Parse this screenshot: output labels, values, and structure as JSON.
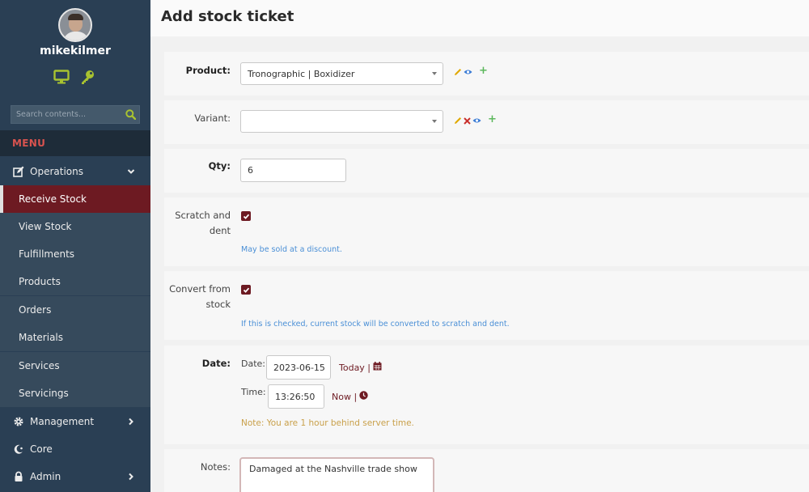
{
  "user": {
    "name": "mikekilmer"
  },
  "sidebar": {
    "search_placeholder": "Search contents...",
    "menu_label": "MENU",
    "groups": {
      "operations": "Operations",
      "management": "Management",
      "core": "Core",
      "admin": "Admin"
    },
    "items": [
      "Receive Stock",
      "View Stock",
      "Fulfillments",
      "Products",
      "Orders",
      "Materials",
      "Services",
      "Servicings"
    ],
    "active_item": "Receive Stock"
  },
  "page": {
    "title": "Add stock ticket"
  },
  "form": {
    "product": {
      "label": "Product:",
      "value": "Tronographic | Boxidizer"
    },
    "variant": {
      "label": "Variant:",
      "value": ""
    },
    "qty": {
      "label": "Qty:",
      "value": "6"
    },
    "scratch": {
      "label_line1": "Scratch and",
      "label_line2": "dent",
      "checked": true,
      "help": "May be sold at a discount."
    },
    "convert": {
      "label_line1": "Convert from",
      "label_line2": "stock",
      "checked": true,
      "help": "If this is checked, current stock will be converted to scratch and dent."
    },
    "date": {
      "label": "Date:",
      "date_label": "Date:",
      "date_value": "2023-06-15",
      "today_link": "Today |",
      "time_label": "Time:",
      "time_value": "13:26:50",
      "now_link": "Now |",
      "note": "Note: You are 1 hour behind server time."
    },
    "notes": {
      "label": "Notes:",
      "value": "Damaged at the Nashville trade show"
    }
  },
  "colors": {
    "sidebar_bg": "#2a3f54",
    "active_bg": "#6d1a22",
    "accent_green": "#a8c230",
    "menu_red": "#d9534f",
    "help_blue": "#4a8fd6",
    "warn_gold": "#c9a04a"
  }
}
